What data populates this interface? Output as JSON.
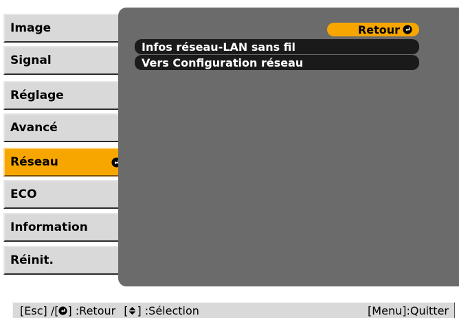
{
  "sidebar": {
    "items": [
      {
        "label": "Image"
      },
      {
        "label": "Signal"
      },
      {
        "label": "Réglage"
      },
      {
        "label": "Avancé"
      },
      {
        "label": "Réseau",
        "active": true
      },
      {
        "label": "ECO"
      },
      {
        "label": "Information"
      },
      {
        "label": "Réinit."
      }
    ]
  },
  "content": {
    "back_button_label": "Retour",
    "options": [
      {
        "label": "Infos réseau-LAN sans fil"
      },
      {
        "label": "Vers Configuration réseau"
      }
    ]
  },
  "footer": {
    "esc_text": "[Esc] /[",
    "back_text": "] :Retour",
    "select_open": "[",
    "select_text": "] :Sélection",
    "quit_text": "[Menu]:Quitter"
  },
  "colors": {
    "panel_gray": "#6b6b6b",
    "active_orange": "#f7a600",
    "option_black": "#1a1a1a",
    "footer_gray": "#d9d9d9"
  },
  "icons": {
    "enter": "enter-icon",
    "up_down": "up-down-arrow-icon"
  }
}
